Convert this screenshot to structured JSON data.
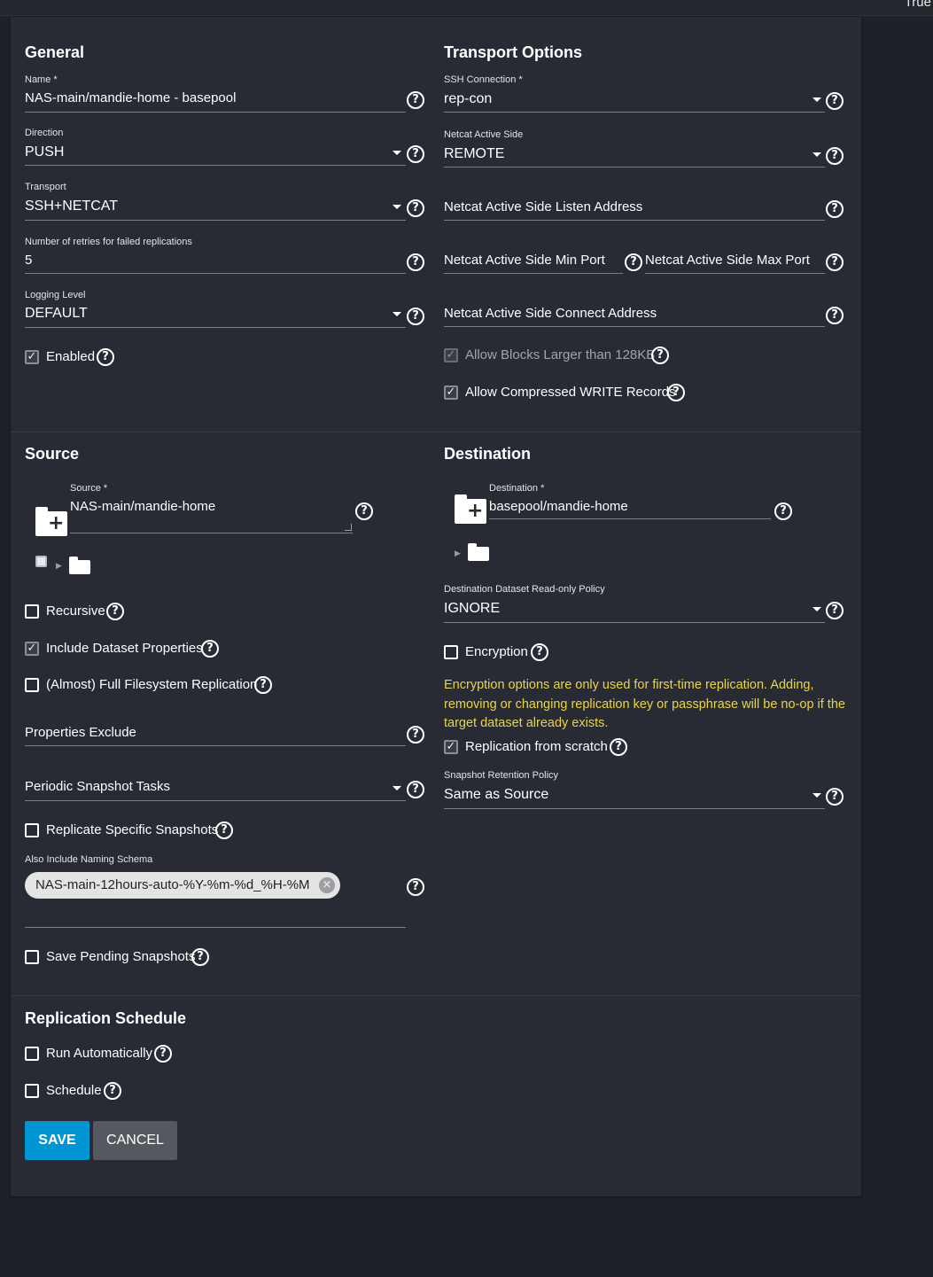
{
  "topbar": {
    "right_text": "True"
  },
  "general": {
    "heading": "General",
    "name": {
      "label": "Name *",
      "value": "NAS-main/mandie-home - basepool"
    },
    "direction": {
      "label": "Direction",
      "value": "PUSH"
    },
    "transport": {
      "label": "Transport",
      "value": "SSH+NETCAT"
    },
    "retries": {
      "label": "Number of retries for failed replications",
      "value": "5"
    },
    "logging": {
      "label": "Logging Level",
      "value": "DEFAULT"
    },
    "enabled": {
      "label": "Enabled",
      "checked": true
    }
  },
  "transport_options": {
    "heading": "Transport Options",
    "ssh_connection": {
      "label": "SSH Connection *",
      "value": "rep-con"
    },
    "netcat_active_side": {
      "label": "Netcat Active Side",
      "value": "REMOTE"
    },
    "listen_address": {
      "placeholder": "Netcat Active Side Listen Address"
    },
    "min_port": {
      "placeholder": "Netcat Active Side Min Port"
    },
    "max_port": {
      "placeholder": "Netcat Active Side Max Port"
    },
    "connect_address": {
      "placeholder": "Netcat Active Side Connect Address"
    },
    "large_block": {
      "label": "Allow Blocks Larger than 128KB",
      "checked": true,
      "disabled": true
    },
    "compressed": {
      "label": "Allow Compressed WRITE Records",
      "checked": true
    }
  },
  "source": {
    "heading": "Source",
    "field": {
      "label": "Source *",
      "value": "NAS-main/mandie-home"
    },
    "recursive": {
      "label": "Recursive",
      "checked": false
    },
    "include_props": {
      "label": "Include Dataset Properties",
      "checked": true
    },
    "full_fs": {
      "label": "(Almost) Full Filesystem Replication",
      "checked": false
    },
    "properties_exclude": {
      "placeholder": "Properties Exclude"
    },
    "periodic_tasks": {
      "placeholder": "Periodic Snapshot Tasks"
    },
    "replicate_specific": {
      "label": "Replicate Specific Snapshots",
      "checked": false
    },
    "naming_schema": {
      "label": "Also Include Naming Schema",
      "chips": [
        "NAS-main-12hours-auto-%Y-%m-%d_%H-%M"
      ]
    },
    "save_pending": {
      "label": "Save Pending Snapshots",
      "checked": false
    }
  },
  "destination": {
    "heading": "Destination",
    "field": {
      "label": "Destination *",
      "value": "basepool/mandie-home"
    },
    "readonly_policy": {
      "label": "Destination Dataset Read-only Policy",
      "value": "IGNORE"
    },
    "encryption": {
      "label": "Encryption",
      "checked": false
    },
    "warning": "Encryption options are only used for first-time replication. Adding, removing or changing replication key or passphrase will be no-op if the target dataset already exists.",
    "from_scratch": {
      "label": "Replication from scratch",
      "checked": true
    },
    "retention": {
      "label": "Snapshot Retention Policy",
      "value": "Same as Source"
    }
  },
  "schedule": {
    "heading": "Replication Schedule",
    "run_auto": {
      "label": "Run Automatically",
      "checked": false
    },
    "schedule": {
      "label": "Schedule",
      "checked": false
    }
  },
  "actions": {
    "save": "SAVE",
    "cancel": "CANCEL"
  },
  "colors": {
    "primary": "#0095d5",
    "warning": "#e8d44d",
    "card": "#282b33",
    "background": "#1e2128"
  },
  "icons": {
    "help": "help-circle-icon",
    "dropdown": "caret-down-icon",
    "folder_add": "folder-plus-icon",
    "folder": "folder-icon",
    "chip_remove": "cancel-circle-icon"
  }
}
